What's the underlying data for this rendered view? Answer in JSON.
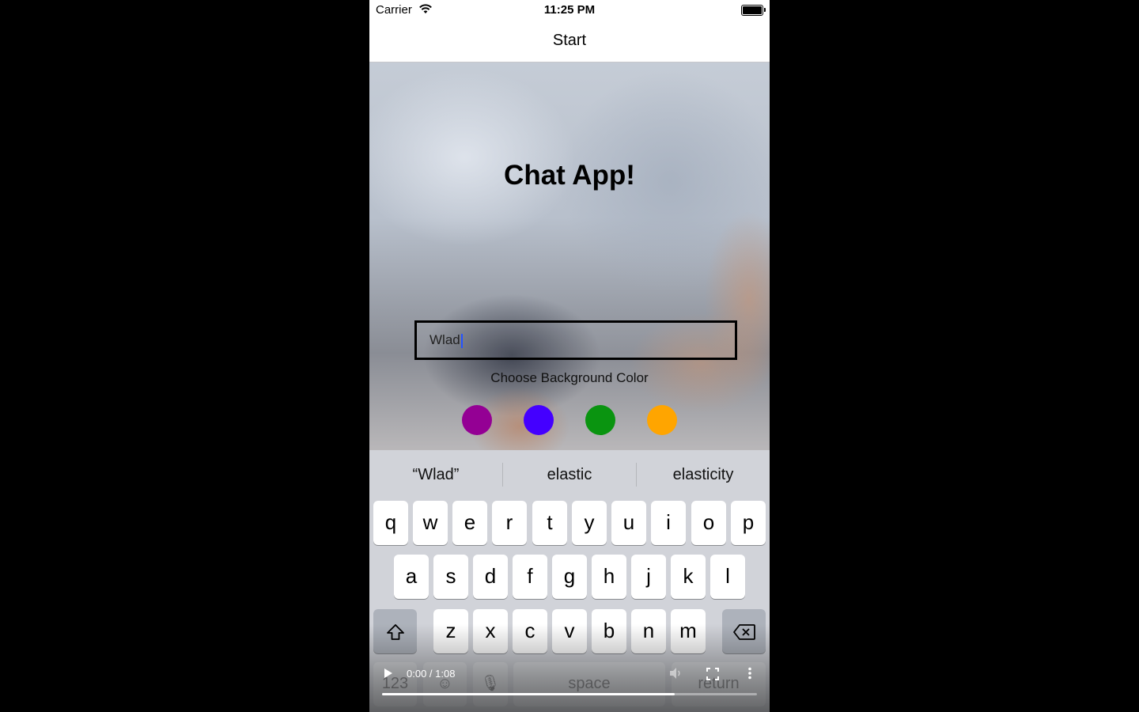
{
  "status_bar": {
    "carrier": "Carrier",
    "time": "11:25 PM"
  },
  "nav": {
    "title": "Start"
  },
  "screen": {
    "title": "Chat App!",
    "name_input": {
      "value": "Wlad"
    },
    "choose_label": "Choose Background Color",
    "colors": [
      {
        "name": "purple",
        "hex": "#940094"
      },
      {
        "name": "blue",
        "hex": "#4400ff"
      },
      {
        "name": "green",
        "hex": "#0a9410"
      },
      {
        "name": "orange",
        "hex": "#ffa500"
      }
    ]
  },
  "keyboard": {
    "suggestions": [
      "“Wlad”",
      "elastic",
      "elasticity"
    ],
    "row1": [
      "q",
      "w",
      "e",
      "r",
      "t",
      "y",
      "u",
      "i",
      "o",
      "p"
    ],
    "row2": [
      "a",
      "s",
      "d",
      "f",
      "g",
      "h",
      "j",
      "k",
      "l"
    ],
    "row3": [
      "z",
      "x",
      "c",
      "v",
      "b",
      "n",
      "m"
    ],
    "bottom": {
      "numbers": "123",
      "space": "space",
      "return": "return"
    }
  },
  "video": {
    "time": "0:00 / 1:08",
    "progress": 0.78
  }
}
